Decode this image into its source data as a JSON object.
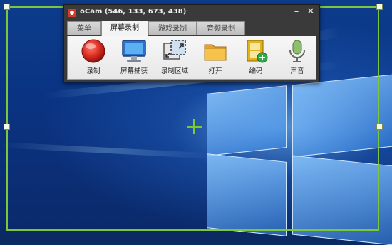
{
  "window": {
    "title": "oCam (546, 133, 673, 438)",
    "minimize_symbol": "–",
    "close_symbol": "✕"
  },
  "tabs": [
    {
      "label": "菜单",
      "active": false
    },
    {
      "label": "屏幕录制",
      "active": true
    },
    {
      "label": "游戏录制",
      "active": false
    },
    {
      "label": "音频录制",
      "active": false
    }
  ],
  "toolbar": [
    {
      "label": "录制",
      "icon": "record-icon"
    },
    {
      "label": "屏幕捕获",
      "icon": "monitor-icon"
    },
    {
      "label": "录制区域",
      "icon": "record-area-icon"
    },
    {
      "label": "打开",
      "icon": "folder-icon"
    },
    {
      "label": "编码",
      "icon": "codec-film-icon"
    },
    {
      "label": "声音",
      "icon": "microphone-icon"
    }
  ],
  "colors": {
    "frame_border": "#7cc63b",
    "crosshair": "#7ec832",
    "record_red": "#d92b20"
  }
}
